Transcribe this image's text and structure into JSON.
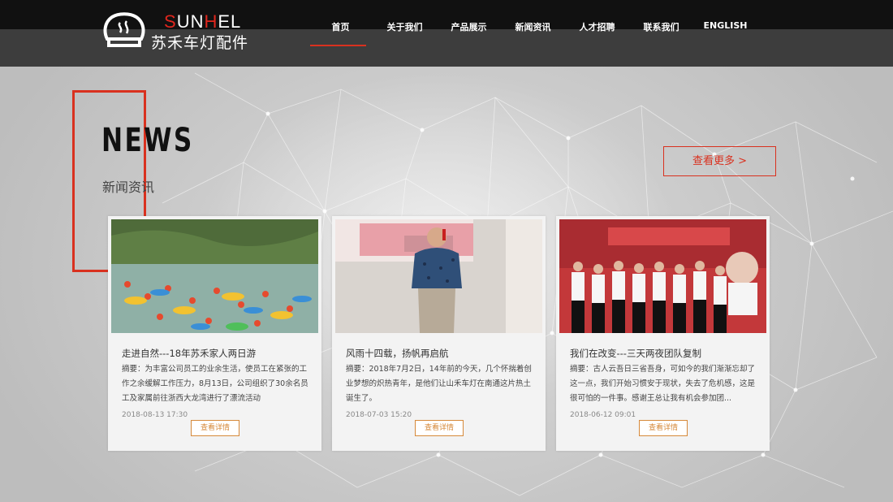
{
  "header": {
    "logo_en_1": "S",
    "logo_en_2": "UN",
    "logo_en_3": "H",
    "logo_en_4": "EL",
    "logo_cn": "苏禾车灯配件",
    "nav": [
      {
        "label": "首页",
        "active": true
      },
      {
        "label": "关于我们"
      },
      {
        "label": "产品展示"
      },
      {
        "label": "新闻资讯"
      },
      {
        "label": "人才招聘"
      },
      {
        "label": "联系我们"
      },
      {
        "label": "ENGLISH"
      }
    ]
  },
  "section": {
    "title": "NEWS",
    "subtitle": "新闻资讯",
    "more_label": "查看更多 >"
  },
  "cards": [
    {
      "title": "走进自然---18年苏禾家人两日游",
      "summary": "摘要：为丰富公司员工的业余生活，使员工在紧张的工作之余缓解工作压力，8月13日，公司组织了30余名员工及家属前往浙西大龙湾进行了漂流活动",
      "date": "2018-08-13 17:30",
      "button": "查看详情"
    },
    {
      "title": "风雨十四载，扬帆再启航",
      "summary": "摘要：2018年7月2日，14年前的今天，几个怀揣着创业梦想的炽热青年，是他们让山禾车灯在南通这片热土诞生了。",
      "date": "2018-07-03 15:20",
      "button": "查看详情"
    },
    {
      "title": "我们在改变---三天两夜团队复制",
      "summary": "摘要：古人云吾日三省吾身，可如今的我们渐渐忘却了这一点，我们开始习惯安于现状，失去了危机感，这是很可怕的一件事。感谢王总让我有机会参加团...",
      "date": "2018-06-12 09:01",
      "button": "查看详情"
    }
  ],
  "colors": {
    "accent": "#d9311f",
    "button_border": "#d6893a"
  }
}
